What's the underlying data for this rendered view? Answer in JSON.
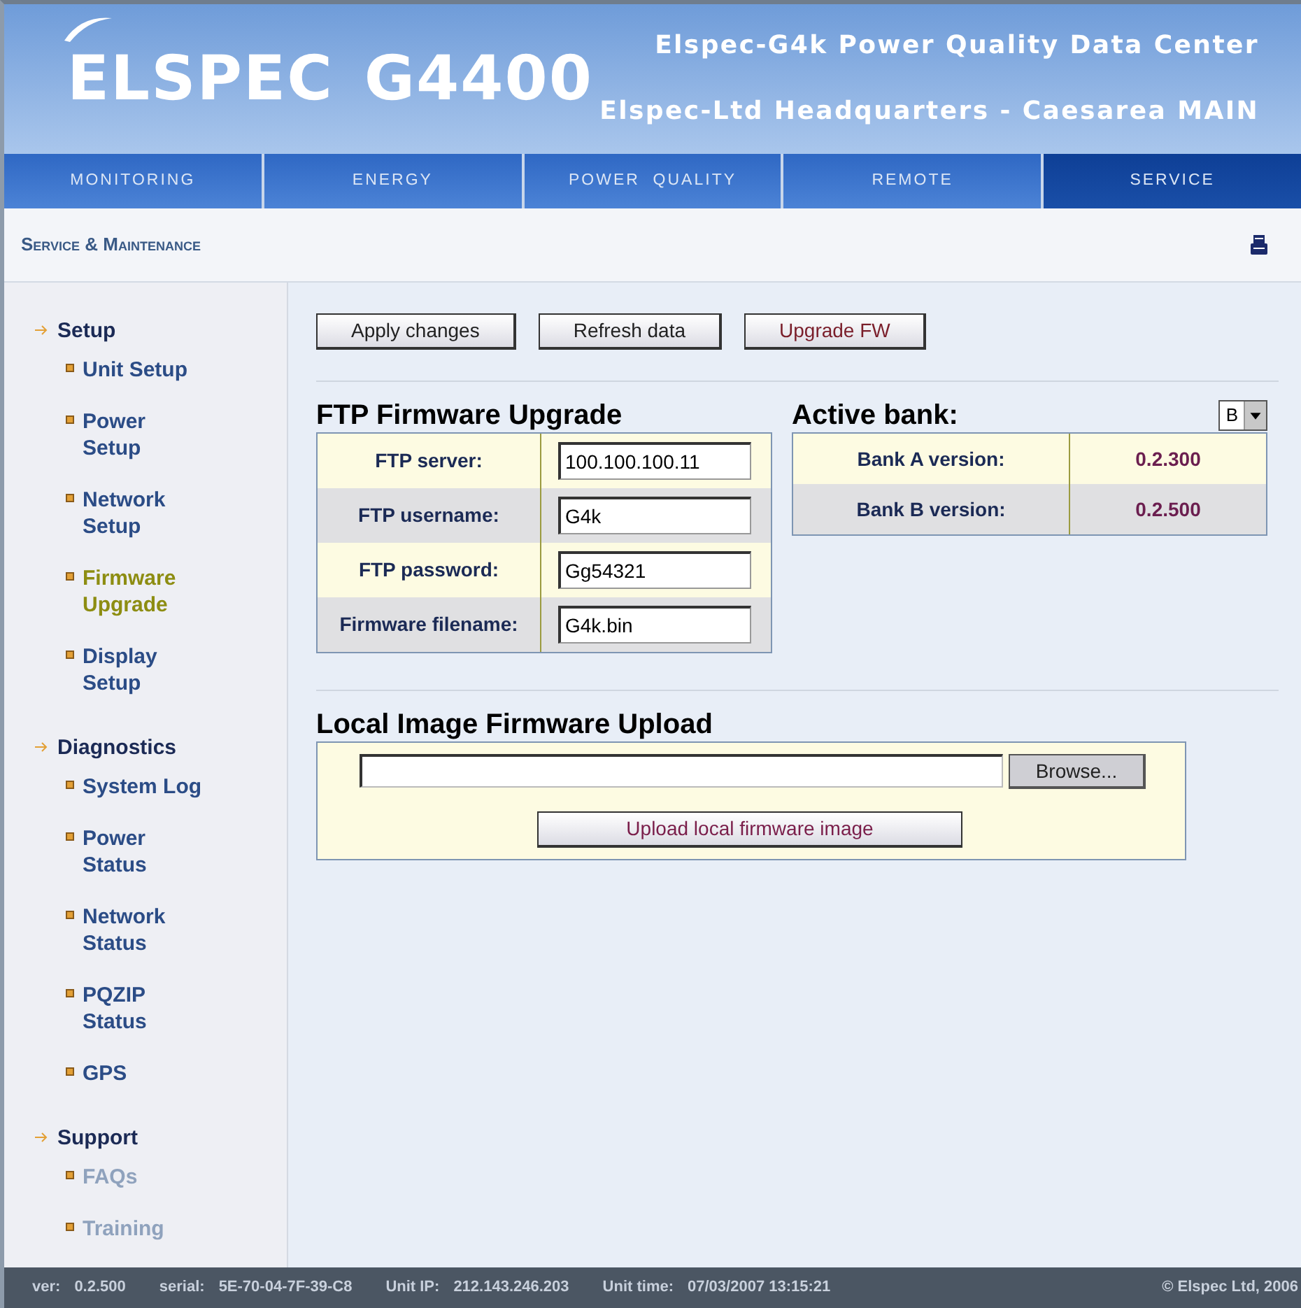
{
  "header": {
    "logo": "ELSPEC",
    "model": "G4400",
    "title": "Elspec-G4k Power Quality Data Center",
    "site": "Elspec-Ltd Headquarters - Caesarea MAIN"
  },
  "nav": [
    {
      "label": "MONITORING",
      "selected": false
    },
    {
      "label": "ENERGY",
      "selected": false
    },
    {
      "label": "POWER  QUALITY",
      "selected": false
    },
    {
      "label": "REMOTE",
      "selected": false
    },
    {
      "label": "SERVICE",
      "selected": true
    }
  ],
  "section_title": "Service & Maintenance",
  "sidebar": [
    {
      "label": "Setup",
      "children": [
        {
          "label": "Unit Setup",
          "selected": false,
          "disabled": false
        },
        {
          "label": "Power Setup",
          "selected": false,
          "disabled": false
        },
        {
          "label": "Network Setup",
          "selected": false,
          "disabled": false
        },
        {
          "label": "Firmware Upgrade",
          "selected": true,
          "disabled": false
        },
        {
          "label": "Display Setup",
          "selected": false,
          "disabled": false
        }
      ]
    },
    {
      "label": "Diagnostics",
      "children": [
        {
          "label": "System Log",
          "selected": false,
          "disabled": false
        },
        {
          "label": "Power Status",
          "selected": false,
          "disabled": false
        },
        {
          "label": "Network Status",
          "selected": false,
          "disabled": false
        },
        {
          "label": "PQZIP Status",
          "selected": false,
          "disabled": false
        },
        {
          "label": "GPS",
          "selected": false,
          "disabled": false
        }
      ]
    },
    {
      "label": "Support",
      "children": [
        {
          "label": "FAQs",
          "selected": false,
          "disabled": true
        },
        {
          "label": "Training",
          "selected": false,
          "disabled": true
        }
      ]
    }
  ],
  "actions": [
    {
      "label": "Apply changes",
      "kind": "normal"
    },
    {
      "label": "Refresh data",
      "kind": "normal"
    },
    {
      "label": "Upgrade FW",
      "kind": "accent"
    }
  ],
  "ftp": {
    "title": "FTP Firmware Upgrade",
    "rows": [
      {
        "label": "FTP server:",
        "value": "100.100.100.11"
      },
      {
        "label": "FTP username:",
        "value": "G4k"
      },
      {
        "label": "FTP password:",
        "value": "Gg54321"
      },
      {
        "label": "Firmware filename:",
        "value": "G4k.bin"
      }
    ]
  },
  "bank": {
    "title": "Active bank:",
    "selection": "B",
    "rows": [
      {
        "label": "Bank A version:",
        "value": "0.2.300"
      },
      {
        "label": "Bank B version:",
        "value": "0.2.500"
      }
    ]
  },
  "local": {
    "title": "Local Image Firmware Upload",
    "browse": "Browse...",
    "upload": "Upload local firmware image"
  },
  "status_bar": [
    {
      "label": "ver:",
      "value": "0.2.500"
    },
    {
      "label": "serial:",
      "value": "5E-70-04-7F-39-C8"
    },
    {
      "label": "Unit IP:",
      "value": "212.143.246.203"
    },
    {
      "label": "Unit time:",
      "value": "07/03/2007 13:15:21"
    }
  ],
  "copyright": "© Elspec Ltd, 2006"
}
